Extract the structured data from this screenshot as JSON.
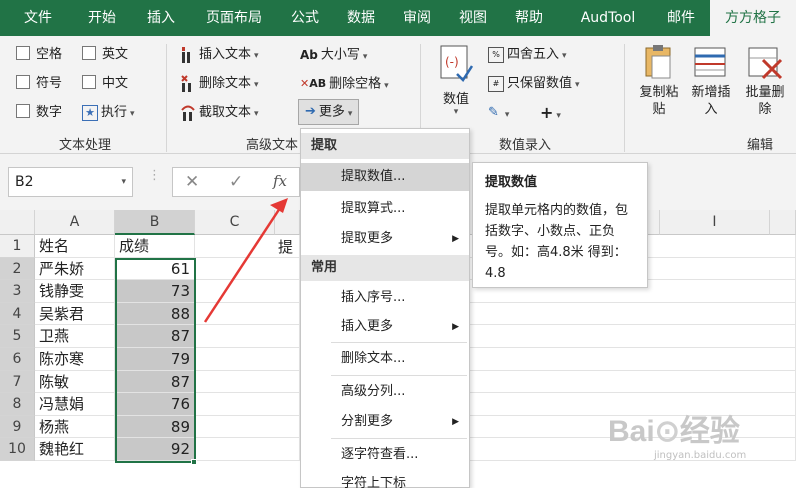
{
  "tabs": [
    "文件",
    "开始",
    "插入",
    "页面布局",
    "公式",
    "数据",
    "审阅",
    "视图",
    "帮助",
    "AudTool",
    "邮件",
    "方方格子"
  ],
  "ribbon": {
    "text_group": {
      "items": [
        "空格",
        "英文",
        "符号",
        "中文",
        "数字",
        "执行"
      ],
      "label": "文本处理"
    },
    "advanced_group": {
      "items": [
        "插入文本",
        "删除文本",
        "截取文本",
        "大小写",
        "删除空格",
        "更多"
      ],
      "label": "高级文本"
    },
    "numeric_group": {
      "number_label": "数值",
      "items": [
        "四舍五入",
        "只保留数值",
        "+"
      ],
      "label": "数值录入"
    },
    "edit_group": {
      "items": [
        "复制粘贴",
        "新增插入",
        "批量删除"
      ],
      "label": "编辑"
    }
  },
  "formula_bar": {
    "name_box": "B2",
    "fx": "fx"
  },
  "grid": {
    "columns": [
      "A",
      "B",
      "C",
      "I"
    ],
    "rows": [
      "1",
      "2",
      "3",
      "4",
      "5",
      "6",
      "7",
      "8",
      "9",
      "10"
    ],
    "cells": [
      [
        "姓名",
        "成绩"
      ],
      [
        "严朱娇",
        "61"
      ],
      [
        "钱静雯",
        "73"
      ],
      [
        "吴紫君",
        "88"
      ],
      [
        "卫燕",
        "87"
      ],
      [
        "陈亦寒",
        "79"
      ],
      [
        "陈敏",
        "87"
      ],
      [
        "冯慧娟",
        "76"
      ],
      [
        "杨燕",
        "89"
      ],
      [
        "魏艳红",
        "92"
      ]
    ],
    "partial_text": "提"
  },
  "menu": {
    "section_extract": "提取",
    "items_extract": [
      "提取数值...",
      "提取算式...",
      "提取更多"
    ],
    "section_common": "常用",
    "items_common": [
      "插入序号...",
      "插入更多",
      "删除文本...",
      "高级分列...",
      "分割更多",
      "逐字符查看...",
      "字符上下标"
    ]
  },
  "tooltip": {
    "title": "提取数值",
    "body": "提取单元格内的数值，包括数字、小数点、正负号。如：高4.8米 得到：4.8"
  },
  "colors": {
    "accent": "#217346",
    "highlight": "#e53935",
    "selection": "#c8c8c8"
  }
}
